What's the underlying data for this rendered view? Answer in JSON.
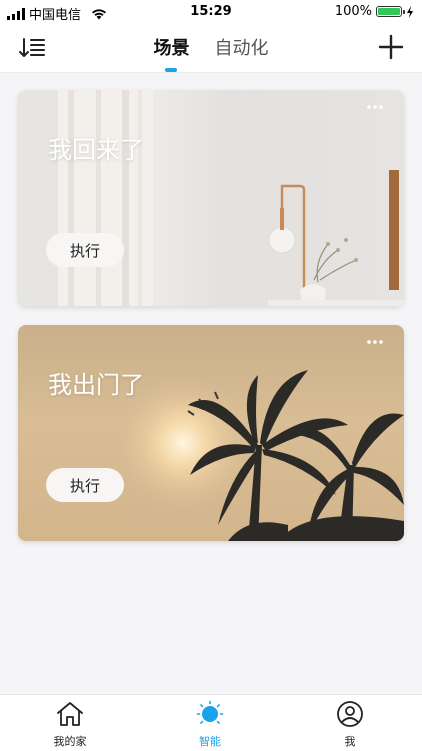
{
  "status_bar": {
    "carrier": "中国电信",
    "time": "15:29",
    "battery": "100%",
    "battery_level": 1.0,
    "battery_color": "#33c759"
  },
  "nav": {
    "tabs": [
      {
        "label": "场景",
        "active": true
      },
      {
        "label": "自动化",
        "active": false
      }
    ],
    "accent_color": "#1aa3e8",
    "sort_icon": "sort-icon",
    "add_icon": "plus-icon"
  },
  "scenes": [
    {
      "title": "我回来了",
      "button_label": "执行",
      "menu_icon": "more-dots-icon"
    },
    {
      "title": "我出门了",
      "button_label": "执行",
      "menu_icon": "more-dots-icon"
    }
  ],
  "tab_bar": {
    "items": [
      {
        "label": "我的家",
        "icon": "home-icon",
        "active": false
      },
      {
        "label": "智能",
        "icon": "sun-icon",
        "active": true
      },
      {
        "label": "我",
        "icon": "user-icon",
        "active": false
      }
    ]
  }
}
